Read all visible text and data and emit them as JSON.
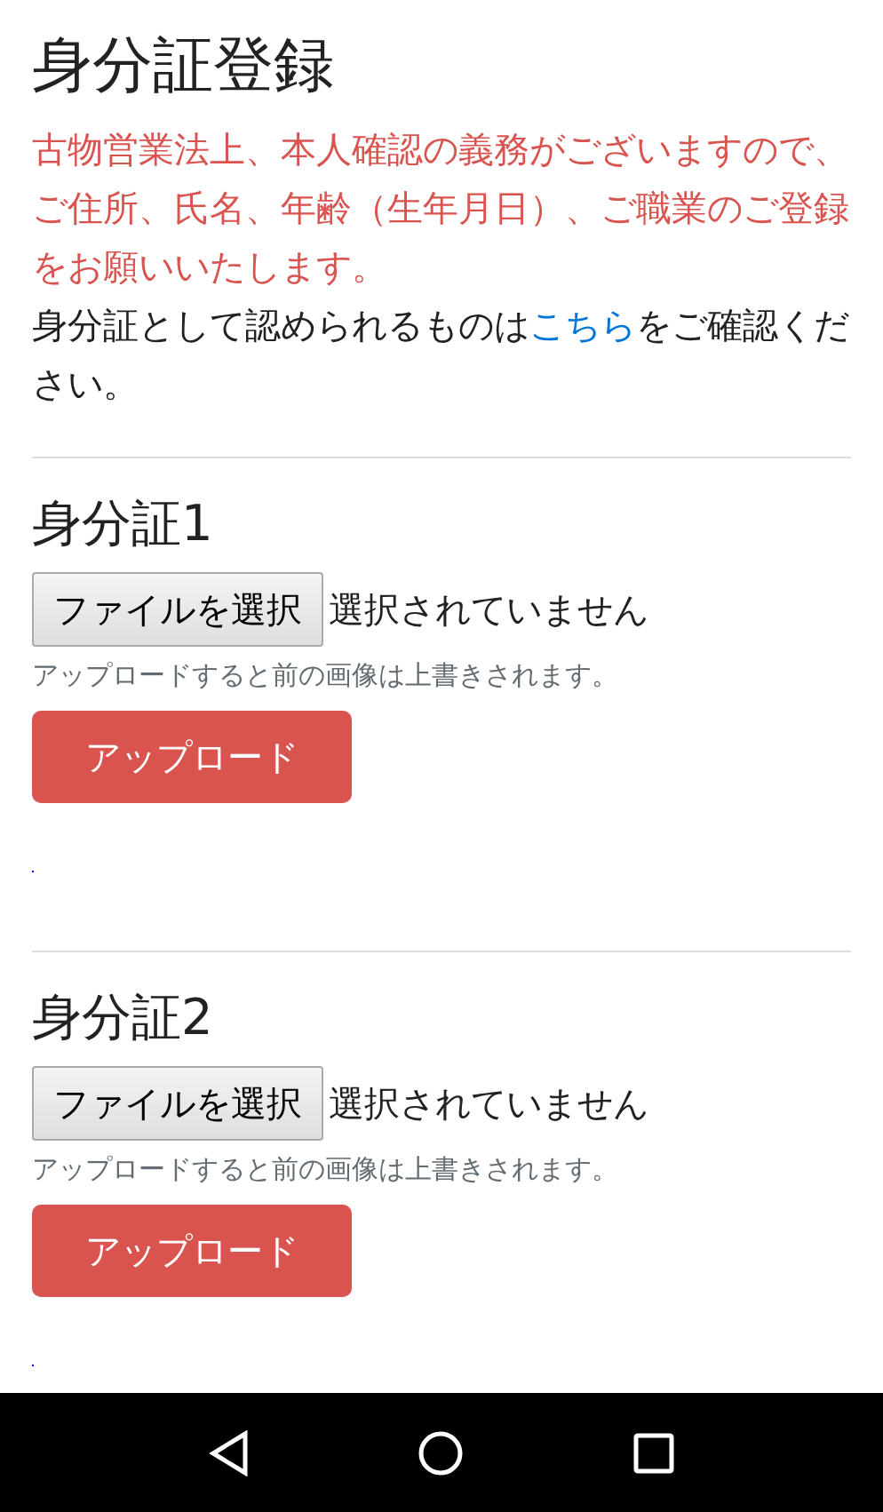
{
  "title": "身分証登録",
  "notice": "古物営業法上、本人確認の義務がございますので、ご住所、氏名、年齢（生年月日）、ご職業のご登録をお願いいたします。",
  "info": {
    "before": "身分証として認められるものは",
    "link": "こちら",
    "after": "をご確認ください。"
  },
  "sections": [
    {
      "heading": "身分証1",
      "file_button": "ファイルを選択",
      "file_status": "選択されていません",
      "hint": "アップロードすると前の画像は上書きされます。",
      "upload_button": "アップロード"
    },
    {
      "heading": "身分証2",
      "file_button": "ファイルを選択",
      "file_status": "選択されていません",
      "hint": "アップロードすると前の画像は上書きされます。",
      "upload_button": "アップロード"
    }
  ]
}
